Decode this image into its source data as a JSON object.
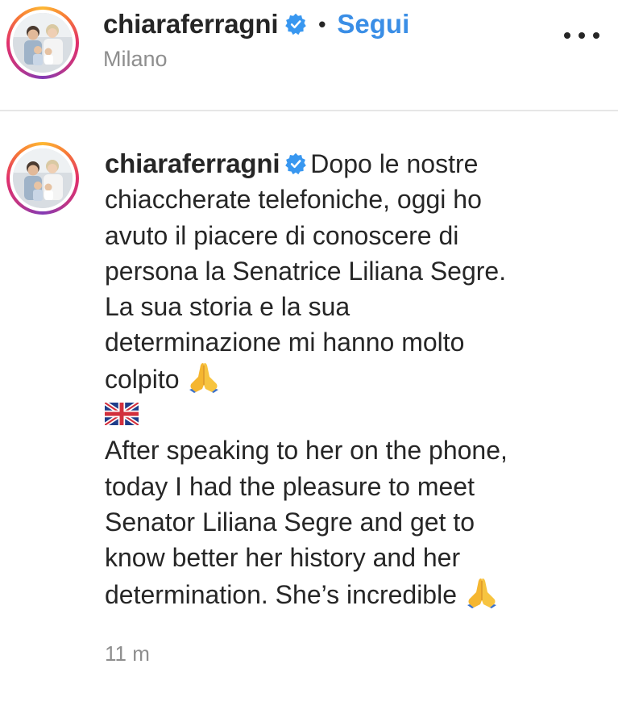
{
  "post": {
    "username": "chiaraferragni",
    "verified": true,
    "separator": "•",
    "follow_label": "Segui",
    "location": "Milano",
    "more_icon": "more-horizontal-icon"
  },
  "caption": {
    "username": "chiaraferragni",
    "text_it_lines": [
      "Dopo le nostre",
      "chiaccherate telefoniche, oggi ho",
      "avuto il piacere di conoscere di",
      "persona la Senatrice Liliana Segre.",
      "La sua storia e la sua",
      "determinazione mi hanno molto",
      "colpito"
    ],
    "flag_icon": "uk-flag-emoji",
    "text_en_lines": [
      "After speaking to her on the phone,",
      "today I had the pleasure to meet",
      "Senator Liliana Segre and get to",
      "know better her history and her",
      "determination. She’s incredible"
    ],
    "emoji_icon": "folded-hands-emoji",
    "timestamp": "11 m"
  },
  "colors": {
    "text": "#262626",
    "secondary": "#8e8e8e",
    "follow_blue": "#3a8ee6",
    "verified_blue": "#3897f0",
    "divider": "#e6e6e6"
  }
}
